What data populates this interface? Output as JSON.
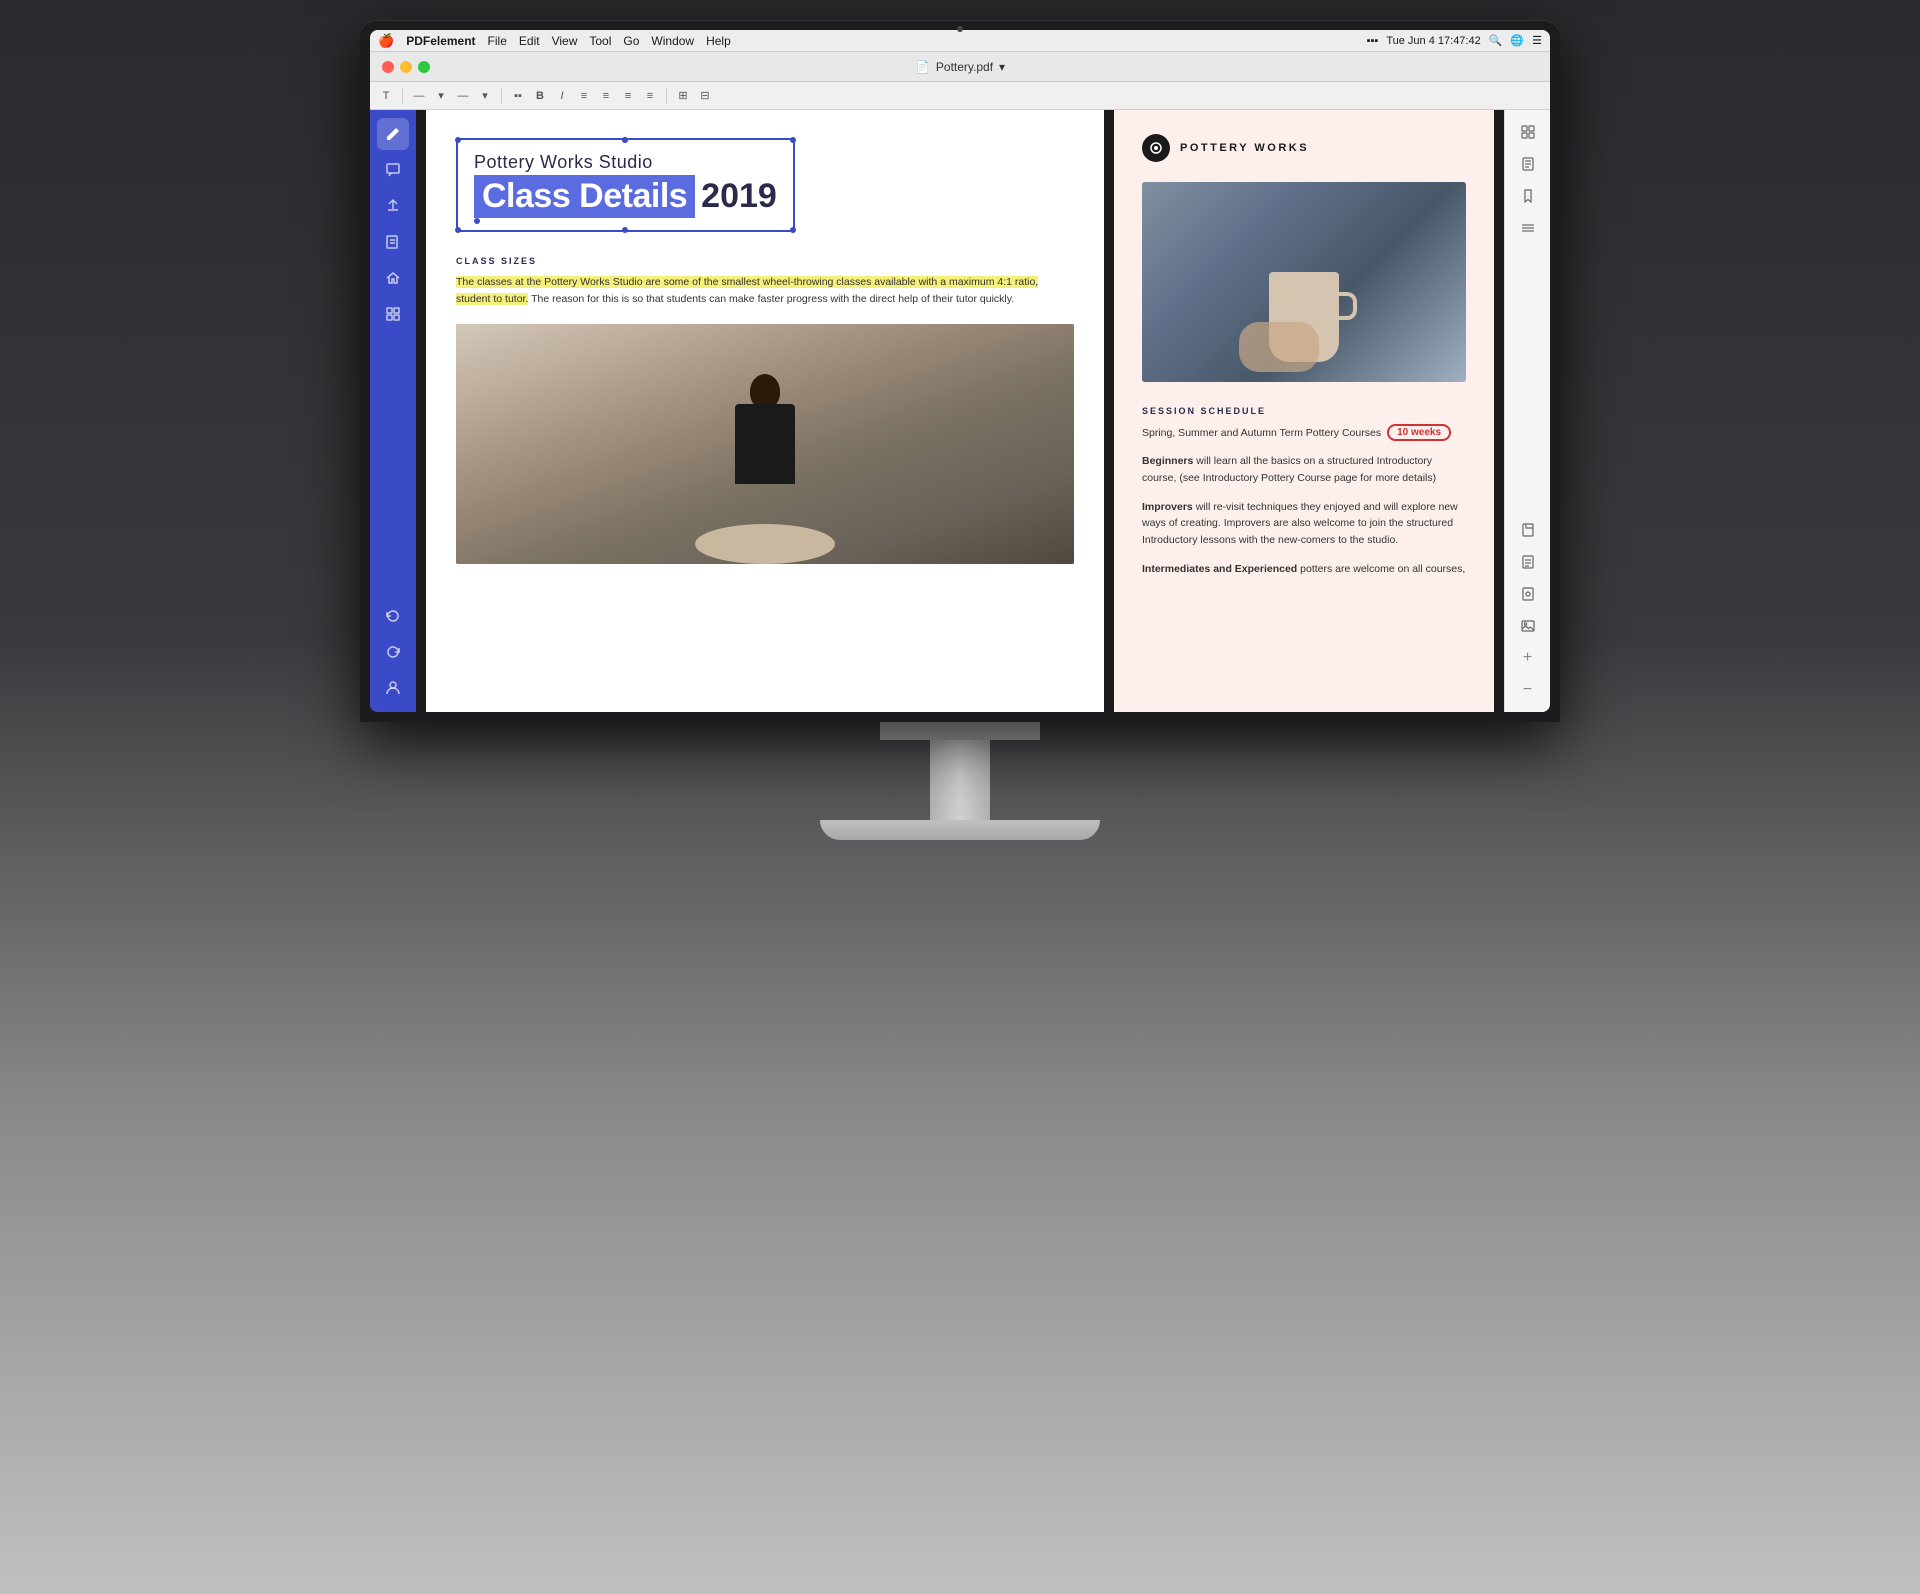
{
  "monitor": {
    "os": "macOS"
  },
  "menubar": {
    "apple": "🍎",
    "app_name": "PDFelement",
    "menus": [
      "File",
      "Edit",
      "View",
      "Tool",
      "Go",
      "Window",
      "Help"
    ],
    "datetime": "Tue Jun 4  17:47:42",
    "file_name": "Pottery.pdf"
  },
  "toolbar": {
    "text_tool": "T",
    "placeholder1": "—",
    "placeholder2": "—"
  },
  "sidebar_left": {
    "icons": [
      "✏️",
      "✉",
      "✈",
      "≡",
      "⌂",
      "⊞",
      "👤"
    ]
  },
  "pdf": {
    "title_subtitle": "Pottery Works Studio",
    "title_main_highlighted": "Class Details",
    "title_main_year": "2019",
    "section1_heading": "CLASS SIZES",
    "section1_text_highlighted": "The classes at the Pottery Works Studio are some of the smallest wheel-throwing classes available with a maximum 4:1 ratio, student to tutor.",
    "section1_text_normal": " The reason for this is so that students can make faster progress with the direct help of their tutor quickly.",
    "logo_text": "POTTERY WORKS",
    "session_heading": "SESSION SCHEDULE",
    "session_line": "Spring, Summer and Autumn Term Pottery Courses",
    "weeks_badge": "10 weeks",
    "beginners_bold": "Beginners",
    "beginners_text": " will learn all the basics on a structured Introductory course, (see Introductory Pottery Course page for more details)",
    "improvers_bold": "Improvers",
    "improvers_text": " will re-visit techniques they enjoyed and will explore new ways of creating. Improvers are also welcome to join the structured Introductory lessons with the new-comers to the studio.",
    "intermediates_bold": "Intermediates and Experienced",
    "intermediates_text": " potters are welcome on all courses,"
  },
  "right_sidebar": {
    "icons": [
      "⊞",
      "📄",
      "🔖",
      "≡",
      "📋",
      "📋",
      "📋",
      "📋",
      "+",
      "—"
    ]
  }
}
